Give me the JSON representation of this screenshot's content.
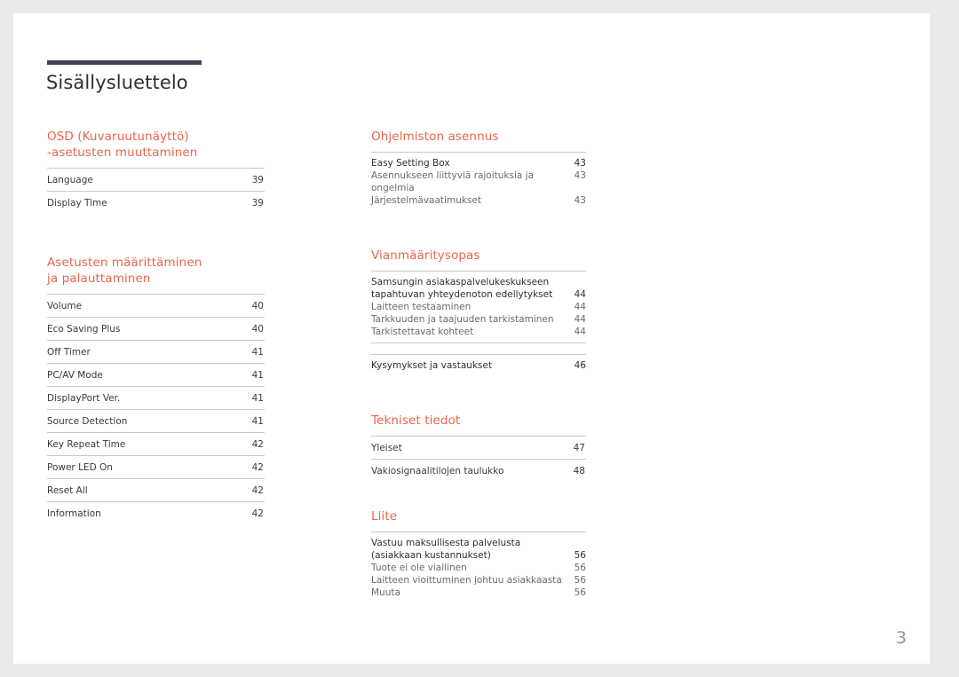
{
  "document": {
    "title": "Sisällysluettelo",
    "page_number": "3",
    "accent_color": "#e8654a",
    "rule_color": "#464455",
    "page_number_color": "#8e93a6"
  },
  "left_column": {
    "sections": [
      {
        "heading_line1": "OSD (Kuvaruutunäyttö)",
        "heading_line2": "-asetusten muuttaminen",
        "style": "spaced",
        "rows": [
          {
            "label": "Language",
            "page": "39"
          },
          {
            "label": "Display Time",
            "page": "39"
          }
        ]
      },
      {
        "heading_line1": "Asetusten määrittäminen",
        "heading_line2": "ja palauttaminen",
        "style": "spaced",
        "rows": [
          {
            "label": "Volume",
            "page": "40"
          },
          {
            "label": "Eco Saving Plus",
            "page": "40"
          },
          {
            "label": "Off Timer",
            "page": "41"
          },
          {
            "label": "PC/AV Mode",
            "page": "41"
          },
          {
            "label": "DisplayPort Ver.",
            "page": "41"
          },
          {
            "label": "Source Detection",
            "page": "41"
          },
          {
            "label": "Key Repeat Time",
            "page": "42"
          },
          {
            "label": "Power LED On",
            "page": "42"
          },
          {
            "label": "Reset All",
            "page": "42"
          },
          {
            "label": "Information",
            "page": "42"
          }
        ]
      }
    ]
  },
  "right_column": {
    "sections": [
      {
        "heading_line1": "Ohjelmiston asennus",
        "heading_line2": "",
        "style": "compact",
        "rows": [
          {
            "label": "Easy Setting Box",
            "page": "43",
            "emphasis": "lead"
          },
          {
            "label": "Asennukseen liittyviä rajoituksia ja ongelmia",
            "page": "43",
            "emphasis": "sub"
          },
          {
            "label": "Järjestelmävaatimukset",
            "page": "43",
            "emphasis": "sub"
          }
        ]
      },
      {
        "heading_line1": "Vianmääritysopas",
        "heading_line2": "",
        "style": "compact",
        "rows": [
          {
            "label_line1": "Samsungin asiakaspalvelukeskukseen",
            "label_line2": "tapahtuvan yhteydenoton edellytykset",
            "page": "44",
            "emphasis": "lead"
          },
          {
            "label": "Laitteen testaaminen",
            "page": "44",
            "emphasis": "sub"
          },
          {
            "label": "Tarkkuuden ja taajuuden tarkistaminen",
            "page": "44",
            "emphasis": "sub"
          },
          {
            "label": "Tarkistettavat kohteet",
            "page": "44",
            "emphasis": "sub"
          }
        ],
        "second_group": [
          {
            "label": "Kysymykset ja vastaukset",
            "page": "46",
            "emphasis": "lead"
          }
        ]
      },
      {
        "heading_line1": "Tekniset tiedot",
        "heading_line2": "",
        "style": "spaced",
        "rows": [
          {
            "label": "Yleiset",
            "page": "47"
          },
          {
            "label": "Vakiosignaalitilojen taulukko",
            "page": "48"
          }
        ]
      },
      {
        "heading_line1": "Liite",
        "heading_line2": "",
        "style": "compact",
        "rows": [
          {
            "label_line1": "Vastuu maksullisesta palvelusta",
            "label_line2": "(asiakkaan kustannukset)",
            "page": "56",
            "emphasis": "lead"
          },
          {
            "label": "Tuote ei ole viallinen",
            "page": "56",
            "emphasis": "sub"
          },
          {
            "label": "Laitteen vioittuminen johtuu asiakkaasta",
            "page": "56",
            "emphasis": "sub"
          },
          {
            "label": "Muuta",
            "page": "56",
            "emphasis": "sub"
          }
        ]
      }
    ]
  }
}
